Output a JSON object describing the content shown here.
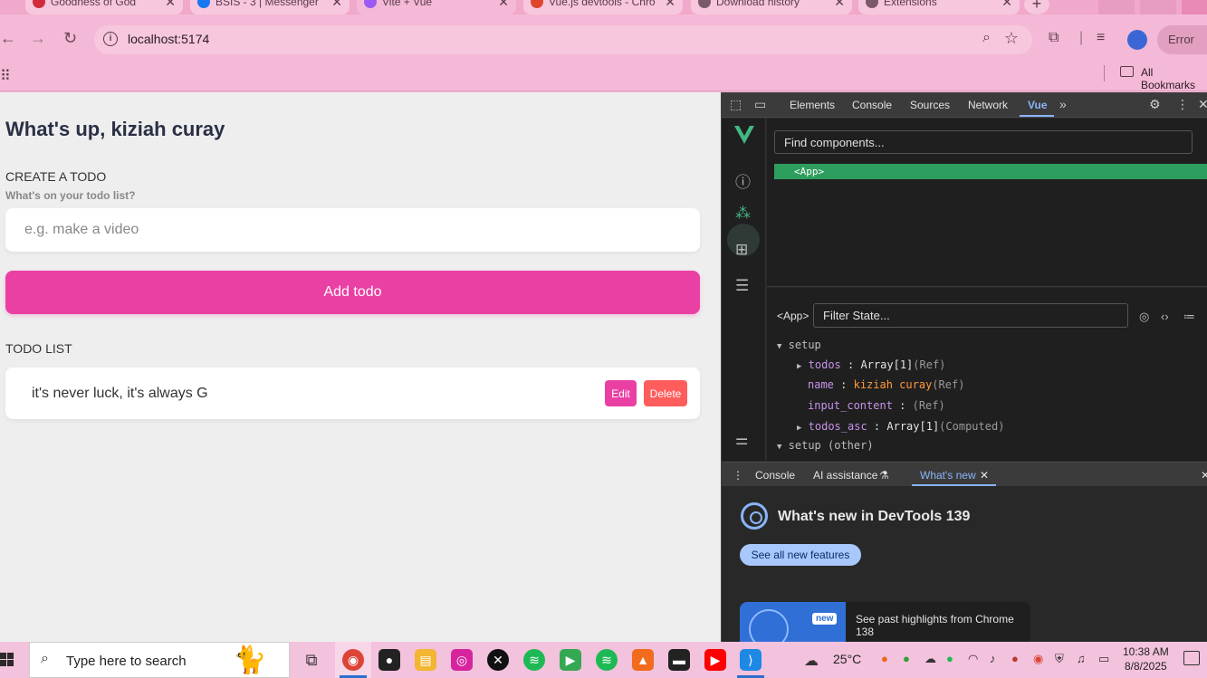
{
  "browser": {
    "tabs": [
      {
        "title": "Goodness of God",
        "color": "#d12b3a"
      },
      {
        "title": "BSIS - 3 | Messenger",
        "color": "#1877f2"
      },
      {
        "title": "Vite + Vue",
        "color": "#9b59f6"
      },
      {
        "title": "Vue.js devtools - Chro",
        "color": "#e0452b"
      },
      {
        "title": "Download history",
        "color": "#7a5a6a"
      },
      {
        "title": "Extensions",
        "color": "#7a5a6a"
      }
    ],
    "url": "localhost:5174",
    "error_label": "Error",
    "bookmarks_label": "All Bookmarks"
  },
  "app": {
    "greeting": "What's up, kiziah curay",
    "create_heading": "CREATE A TODO",
    "create_subheading": "What's on your todo list?",
    "input_placeholder": "e.g. make a video",
    "add_button": "Add todo",
    "list_heading": "TODO LIST",
    "todos": [
      {
        "content": "it's never luck, it's always G",
        "edit_label": "Edit",
        "delete_label": "Delete"
      }
    ]
  },
  "devtools": {
    "tabs": [
      "Elements",
      "Console",
      "Sources",
      "Network",
      "Vue"
    ],
    "active_tab": "Vue",
    "find_placeholder": "Find components...",
    "root_component": "<App>",
    "state_component": "<App>",
    "filter_placeholder": "Filter State...",
    "state": {
      "section1": "setup",
      "rows": [
        {
          "key": "todos",
          "value": "Array[1]",
          "meta": "(Ref)"
        },
        {
          "key": "name",
          "value": "kiziah curay",
          "meta": "(Ref)"
        },
        {
          "key": "input_content",
          "value": "",
          "meta": "(Ref)"
        },
        {
          "key": "todos_asc",
          "value": "Array[1]",
          "meta": "(Computed)"
        }
      ],
      "section2": "setup (other)"
    },
    "drawer_tabs": [
      "Console",
      "AI assistance",
      "What's new"
    ],
    "whats_new_title": "What's new in DevTools 139",
    "see_all_button": "See all new features",
    "highlight_badge": "new",
    "highlight_text": "See past highlights from Chrome 138"
  },
  "taskbar": {
    "search_placeholder": "Type here to search",
    "weather": "25°C",
    "time": "10:38 AM",
    "date": "8/8/2025"
  }
}
